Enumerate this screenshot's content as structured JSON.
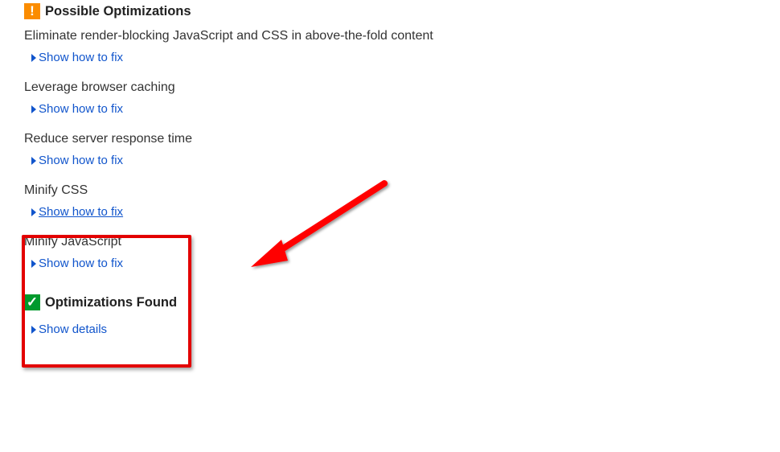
{
  "sections": {
    "possible": {
      "title": "Possible Optimizations",
      "badge_glyph": "!"
    },
    "found": {
      "title": "Optimizations Found",
      "badge_glyph": "✓"
    }
  },
  "items": [
    {
      "title": "Eliminate render-blocking JavaScript and CSS in above-the-fold content",
      "action": "Show how to fix",
      "underline": false
    },
    {
      "title": "Leverage browser caching",
      "action": "Show how to fix",
      "underline": false
    },
    {
      "title": "Reduce server response time",
      "action": "Show how to fix",
      "underline": false
    },
    {
      "title": "Minify CSS",
      "action": "Show how to fix",
      "underline": true
    },
    {
      "title": "Minify JavaScript",
      "action": "Show how to fix",
      "underline": false
    }
  ],
  "found_action": "Show details"
}
